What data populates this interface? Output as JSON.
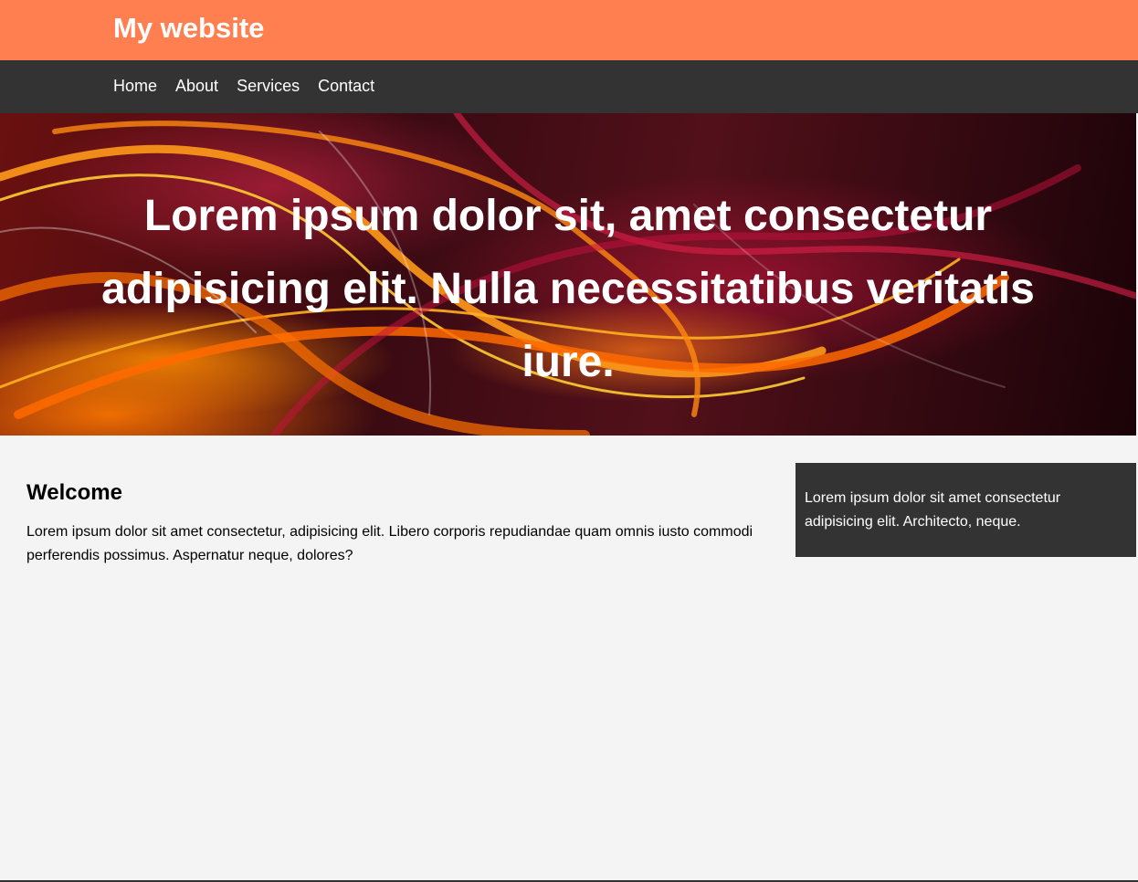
{
  "header": {
    "title": "My website",
    "bg_color": "#ff7f50"
  },
  "nav": {
    "items": [
      {
        "label": "Home"
      },
      {
        "label": "About"
      },
      {
        "label": "Services"
      },
      {
        "label": "Contact"
      }
    ],
    "bg_color": "#333333"
  },
  "hero": {
    "text": "Lorem ipsum dolor sit, amet consectetur adipisicing elit. Nulla necessitatibus veritatis iure."
  },
  "main": {
    "heading": "Welcome",
    "body": "Lorem ipsum dolor sit amet consectetur, adipisicing elit. Libero corporis repudiandae quam omnis iusto commodi perferendis possimus. Aspernatur neque, dolores?"
  },
  "sidebar": {
    "text": "Lorem ipsum dolor sit amet consectetur adipisicing elit. Architecto, neque."
  }
}
